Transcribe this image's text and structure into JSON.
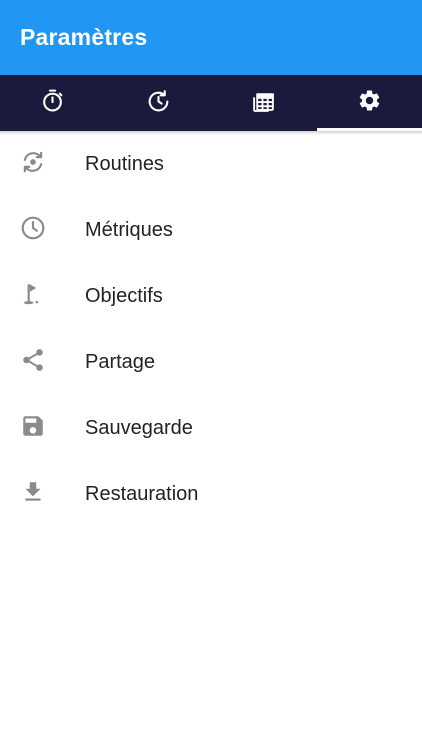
{
  "header": {
    "title": "Paramètres"
  },
  "tabs": [
    {
      "icon": "timer-icon",
      "active": false
    },
    {
      "icon": "history-icon",
      "active": false
    },
    {
      "icon": "calendar-icon",
      "active": false
    },
    {
      "icon": "gear-icon",
      "active": true
    }
  ],
  "menu": [
    {
      "label": "Routines",
      "icon": "routine-icon"
    },
    {
      "label": "Métriques",
      "icon": "clock-icon"
    },
    {
      "label": "Objectifs",
      "icon": "flag-icon"
    },
    {
      "label": "Partage",
      "icon": "share-icon"
    },
    {
      "label": "Sauvegarde",
      "icon": "save-icon"
    },
    {
      "label": "Restauration",
      "icon": "download-icon"
    }
  ],
  "colors": {
    "appbar": "#2196f3",
    "tabbar": "#1a1a3d",
    "icon_gray": "#8a8a8a"
  }
}
